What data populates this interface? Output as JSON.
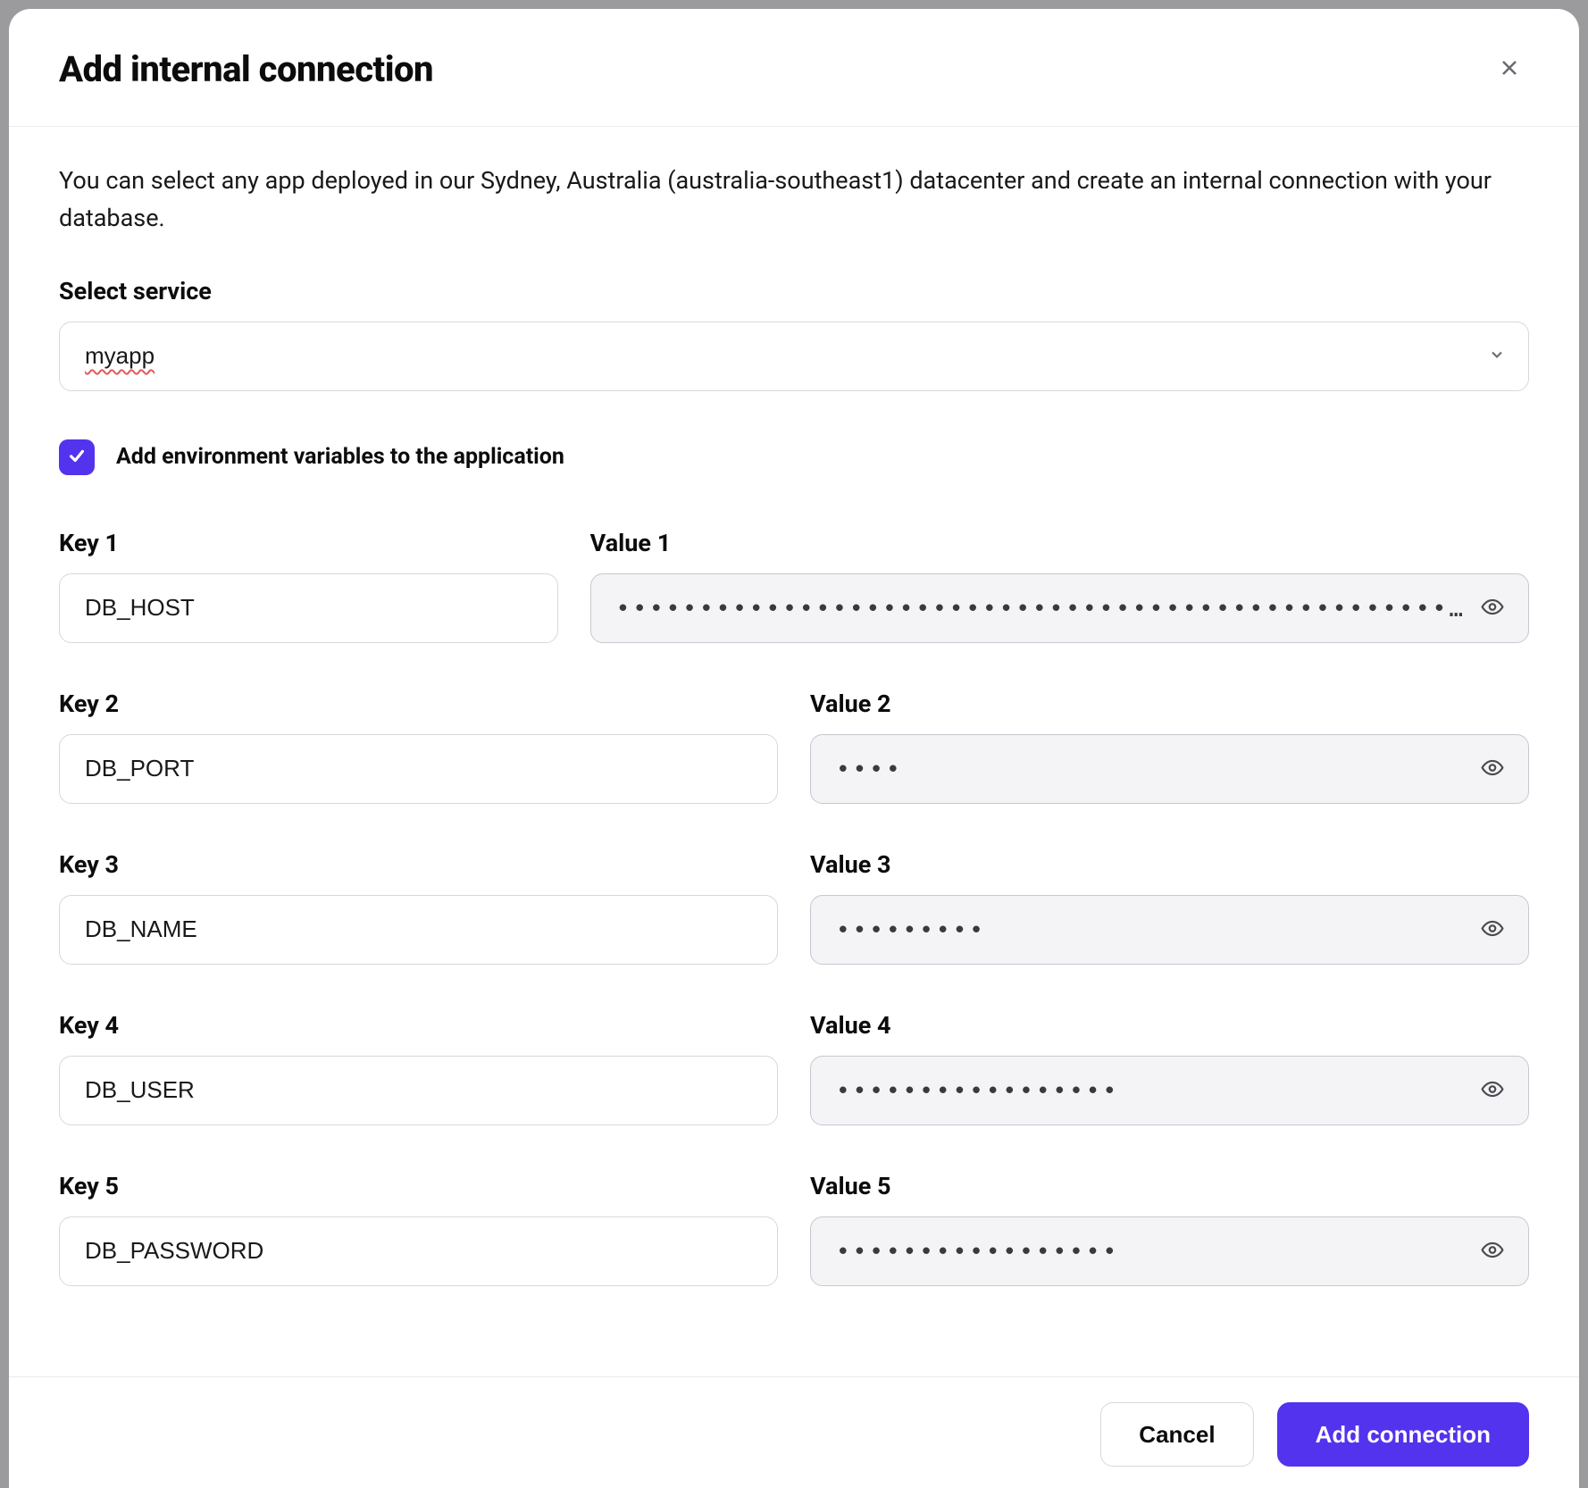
{
  "modal": {
    "title": "Add internal connection",
    "intro": "You can select any app deployed in our Sydney, Australia (australia-southeast1) datacenter and create an internal connection with your database.",
    "select_label": "Select service",
    "select_value": "myapp",
    "checkbox_label": "Add environment variables to the application",
    "checkbox_checked": true
  },
  "pairs": [
    {
      "key_label": "Key 1",
      "value_label": "Value 1",
      "key": "DB_HOST",
      "masked": "••••••••••••••••••••••••••••••••••••••••••••••••••…"
    },
    {
      "key_label": "Key 2",
      "value_label": "Value 2",
      "key": "DB_PORT",
      "masked": "••••"
    },
    {
      "key_label": "Key 3",
      "value_label": "Value 3",
      "key": "DB_NAME",
      "masked": "•••••••••"
    },
    {
      "key_label": "Key 4",
      "value_label": "Value 4",
      "key": "DB_USER",
      "masked": "•••••••••••••••••"
    },
    {
      "key_label": "Key 5",
      "value_label": "Value 5",
      "key": "DB_PASSWORD",
      "masked": "•••••••••••••••••"
    }
  ],
  "footer": {
    "cancel": "Cancel",
    "submit": "Add connection"
  }
}
